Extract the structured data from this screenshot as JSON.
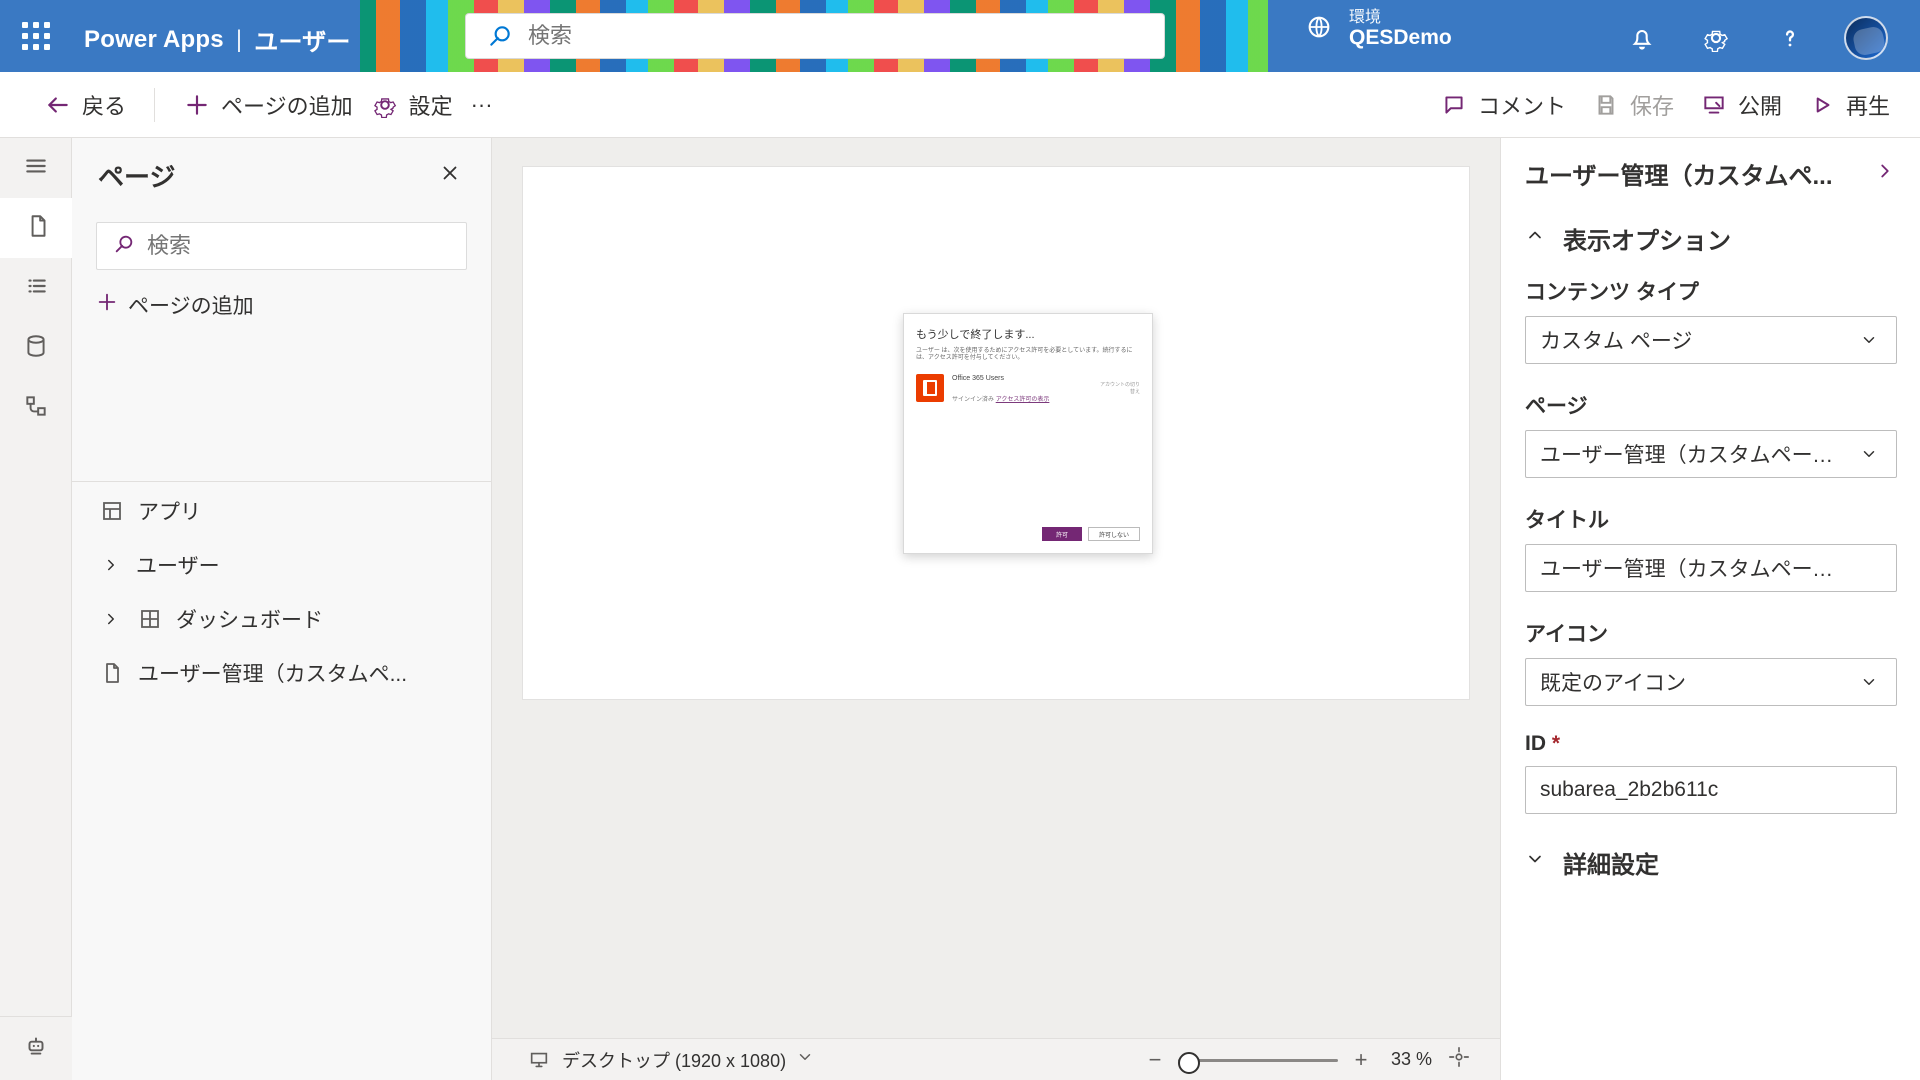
{
  "colors": {
    "brand": "#742774",
    "ink": "#323130",
    "muted": "#605e5c"
  },
  "topbar": {
    "app_name": "Power Apps",
    "separator": "|",
    "section": "ユーザー",
    "search_placeholder": "検索",
    "env_label": "環境",
    "env_name": "QESDemo"
  },
  "commandbar": {
    "back_label": "戻る",
    "add_page_label": "ページの追加",
    "settings_label": "設定",
    "more_label": "···",
    "comment_label": "コメント",
    "save_label": "保存",
    "publish_label": "公開",
    "play_label": "再生"
  },
  "pages_panel": {
    "title": "ページ",
    "search_placeholder": "検索",
    "add_page_label": "ページの追加",
    "items": [
      {
        "label": "アプリ",
        "icon": "app-grid-icon"
      },
      {
        "label": "ユーザー",
        "icon": "chevron-right-icon"
      },
      {
        "label": "ダッシュボード",
        "icon": "dashboard-icon"
      },
      {
        "label": "ユーザー管理（カスタムペ...",
        "icon": "page-icon"
      }
    ]
  },
  "dialog": {
    "title": "もう少しで終了します...",
    "desc": "ユーザー は、次を使用するためにアクセス許可を必要としています。続行するには、アクセス許可を付与してください。",
    "service": "Office 365 Users",
    "signed_in_prefix": "サインイン済み",
    "link": "アクセス許可の表示",
    "side": "アカウントの切り替え",
    "allow": "許可",
    "deny": "許可しない"
  },
  "canvas_footer": {
    "device": "デスクトップ (1920 x 1080)",
    "zoom": "33 %",
    "zoom_value": 33
  },
  "props": {
    "header_title": "ユーザー管理（カスタムペ...",
    "display_options": "表示オプション",
    "content_type_label": "コンテンツ タイプ",
    "content_type_value": "カスタム ページ",
    "page_label": "ページ",
    "page_value": "ユーザー管理（カスタムページ...",
    "title_label": "タイトル",
    "title_value": "ユーザー管理（カスタムページ）",
    "icon_label": "アイコン",
    "icon_value": "既定のアイコン",
    "id_label": "ID",
    "id_required": "*",
    "id_value": "subarea_2b2b611c",
    "advanced": "詳細設定"
  }
}
